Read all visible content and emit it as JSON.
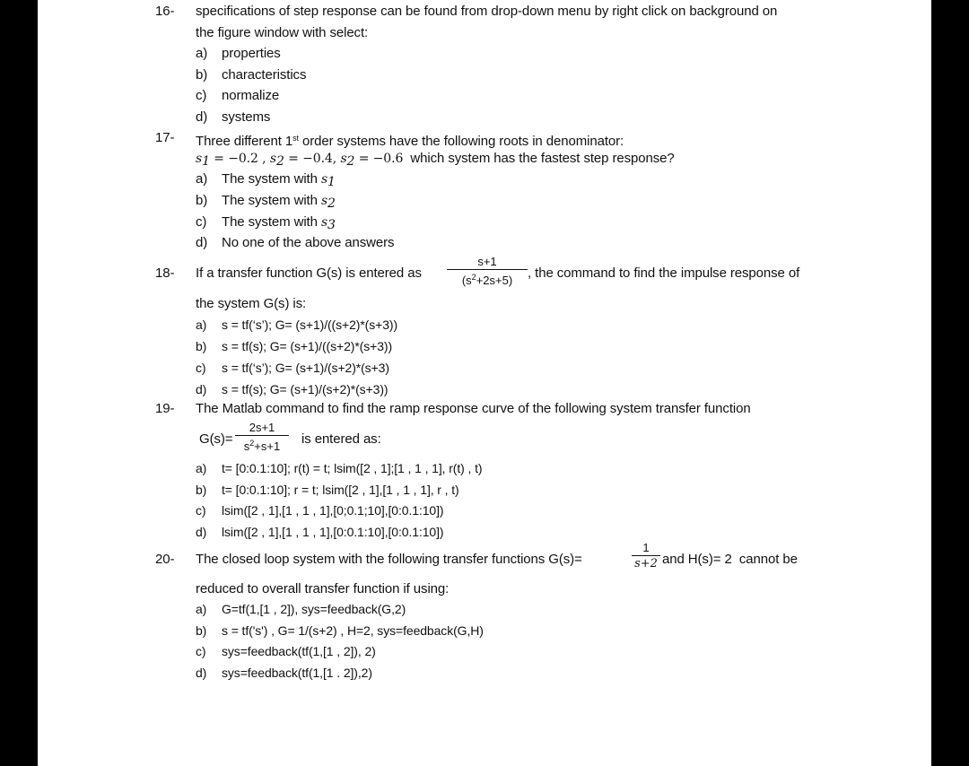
{
  "questions": [
    {
      "number": "16-",
      "stem_line1": "specifications of step response can be found from drop-down menu by right click on background on",
      "stem_line2": "the figure window with select:",
      "options": [
        {
          "label": "a)",
          "text": "properties"
        },
        {
          "label": "b)",
          "text": "characteristics"
        },
        {
          "label": "c)",
          "text": "normalize"
        },
        {
          "label": "d)",
          "text": "systems"
        }
      ]
    },
    {
      "number": "17-",
      "stem_pre": "Three different 1",
      "stem_sup": "st",
      "stem_post": " order systems have the following roots in denominator:",
      "roots": {
        "s1_var": "s",
        "s1_sub": "1",
        "s1_val": " = −0.2 , ",
        "s2_var": "s",
        "s2_sub": "2",
        "s2_val": " = −0.4, ",
        "s3_var": "s",
        "s3_sub": "2",
        "s3_val": " = −0.6",
        "question": "which system has the fastest step response?"
      },
      "options": [
        {
          "label": "a)",
          "text": "The system with ",
          "var": "s",
          "sub": "1"
        },
        {
          "label": "b)",
          "text": "The system with ",
          "var": "s",
          "sub": "2"
        },
        {
          "label": "c)",
          "text": "The system with ",
          "var": "s",
          "sub": "3"
        },
        {
          "label": "d)",
          "text": "No one of the above answers"
        }
      ]
    },
    {
      "number": "18-",
      "stem_pre": "If a transfer function G(s) is entered as",
      "frac_num": "s+1",
      "frac_den_pre": "(s",
      "frac_den_sup": "2",
      "frac_den_post": "+2s+5)",
      "stem_post": ", the command to find the impulse response of",
      "stem_line2": "the system G(s) is:",
      "options": [
        {
          "label": "a)",
          "text": "s = tf(‘s’); G= (s+1)/((s+2)*(s+3))"
        },
        {
          "label": "b)",
          "text": "s = tf(s); G= (s+1)/((s+2)*(s+3))"
        },
        {
          "label": "c)",
          "text": "s = tf(‘s’); G= (s+1)/(s+2)*(s+3)"
        },
        {
          "label": "d)",
          "text": "s = tf(s); G= (s+1)/(s+2)*(s+3))"
        }
      ]
    },
    {
      "number": "19-",
      "stem_line1": "The Matlab command to find the ramp response curve of the following system transfer function",
      "g_label": "G(s)=",
      "frac_num": "2s+1",
      "frac_den_pre": "s",
      "frac_den_sup": "2",
      "frac_den_post": "+s+1",
      "stem_post": "is entered as:",
      "options": [
        {
          "label": "a)",
          "text": "t= [0:0.1:10]; r(t) = t; lsim([2 , 1];[1 , 1 , 1], r(t) , t)"
        },
        {
          "label": "b)",
          "text": "t= [0:0.1:10]; r = t; lsim([2 , 1],[1 , 1 , 1], r , t)"
        },
        {
          "label": "c)",
          "text": "lsim([2 , 1],[1 , 1 , 1],[0;0.1;10],[0:0.1:10])"
        },
        {
          "label": "d)",
          "text": "lsim([2 , 1],[1 , 1 , 1],[0:0.1:10],[0:0.1:10])"
        }
      ]
    },
    {
      "number": "20-",
      "stem_pre": "The closed loop system with the following transfer functions G(s)=",
      "frac_num": "1",
      "frac_den": "s+2",
      "stem_post": "and H(s)= 2  cannot be",
      "stem_line2": "reduced to overall transfer function if using:",
      "options": [
        {
          "label": "a)",
          "text": "G=tf(1,[1 , 2]), sys=feedback(G,2)"
        },
        {
          "label": "b)",
          "text": "s = tf('s') , G= 1/(s+2) , H=2, sys=feedback(G,H)"
        },
        {
          "label": "c)",
          "text": "sys=feedback(tf(1,[1 , 2]), 2)"
        },
        {
          "label": "d)",
          "text": "sys=feedback(tf(1,[1 . 2]),2)"
        }
      ]
    }
  ]
}
